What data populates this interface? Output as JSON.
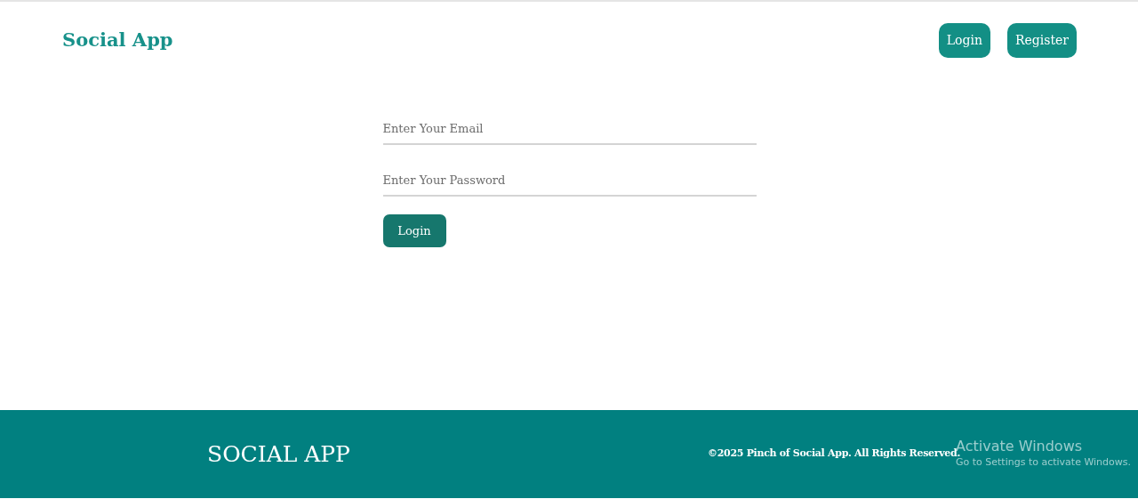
{
  "header": {
    "logo": "Social App",
    "nav_buttons": [
      "Login",
      "Register"
    ]
  },
  "login_form": {
    "email": {
      "placeholder": "Enter Your Email"
    },
    "password": {
      "placeholder": "Enter Your Password"
    },
    "submit": "Login"
  },
  "footer": {
    "brand": "SOCIAL APP",
    "copyright": "©2025 Pinch of Social App. All Rights Reserved."
  },
  "os_overlay": {
    "title": "Activate Windows",
    "subtitle": "Go to Settings to activate Windows."
  }
}
